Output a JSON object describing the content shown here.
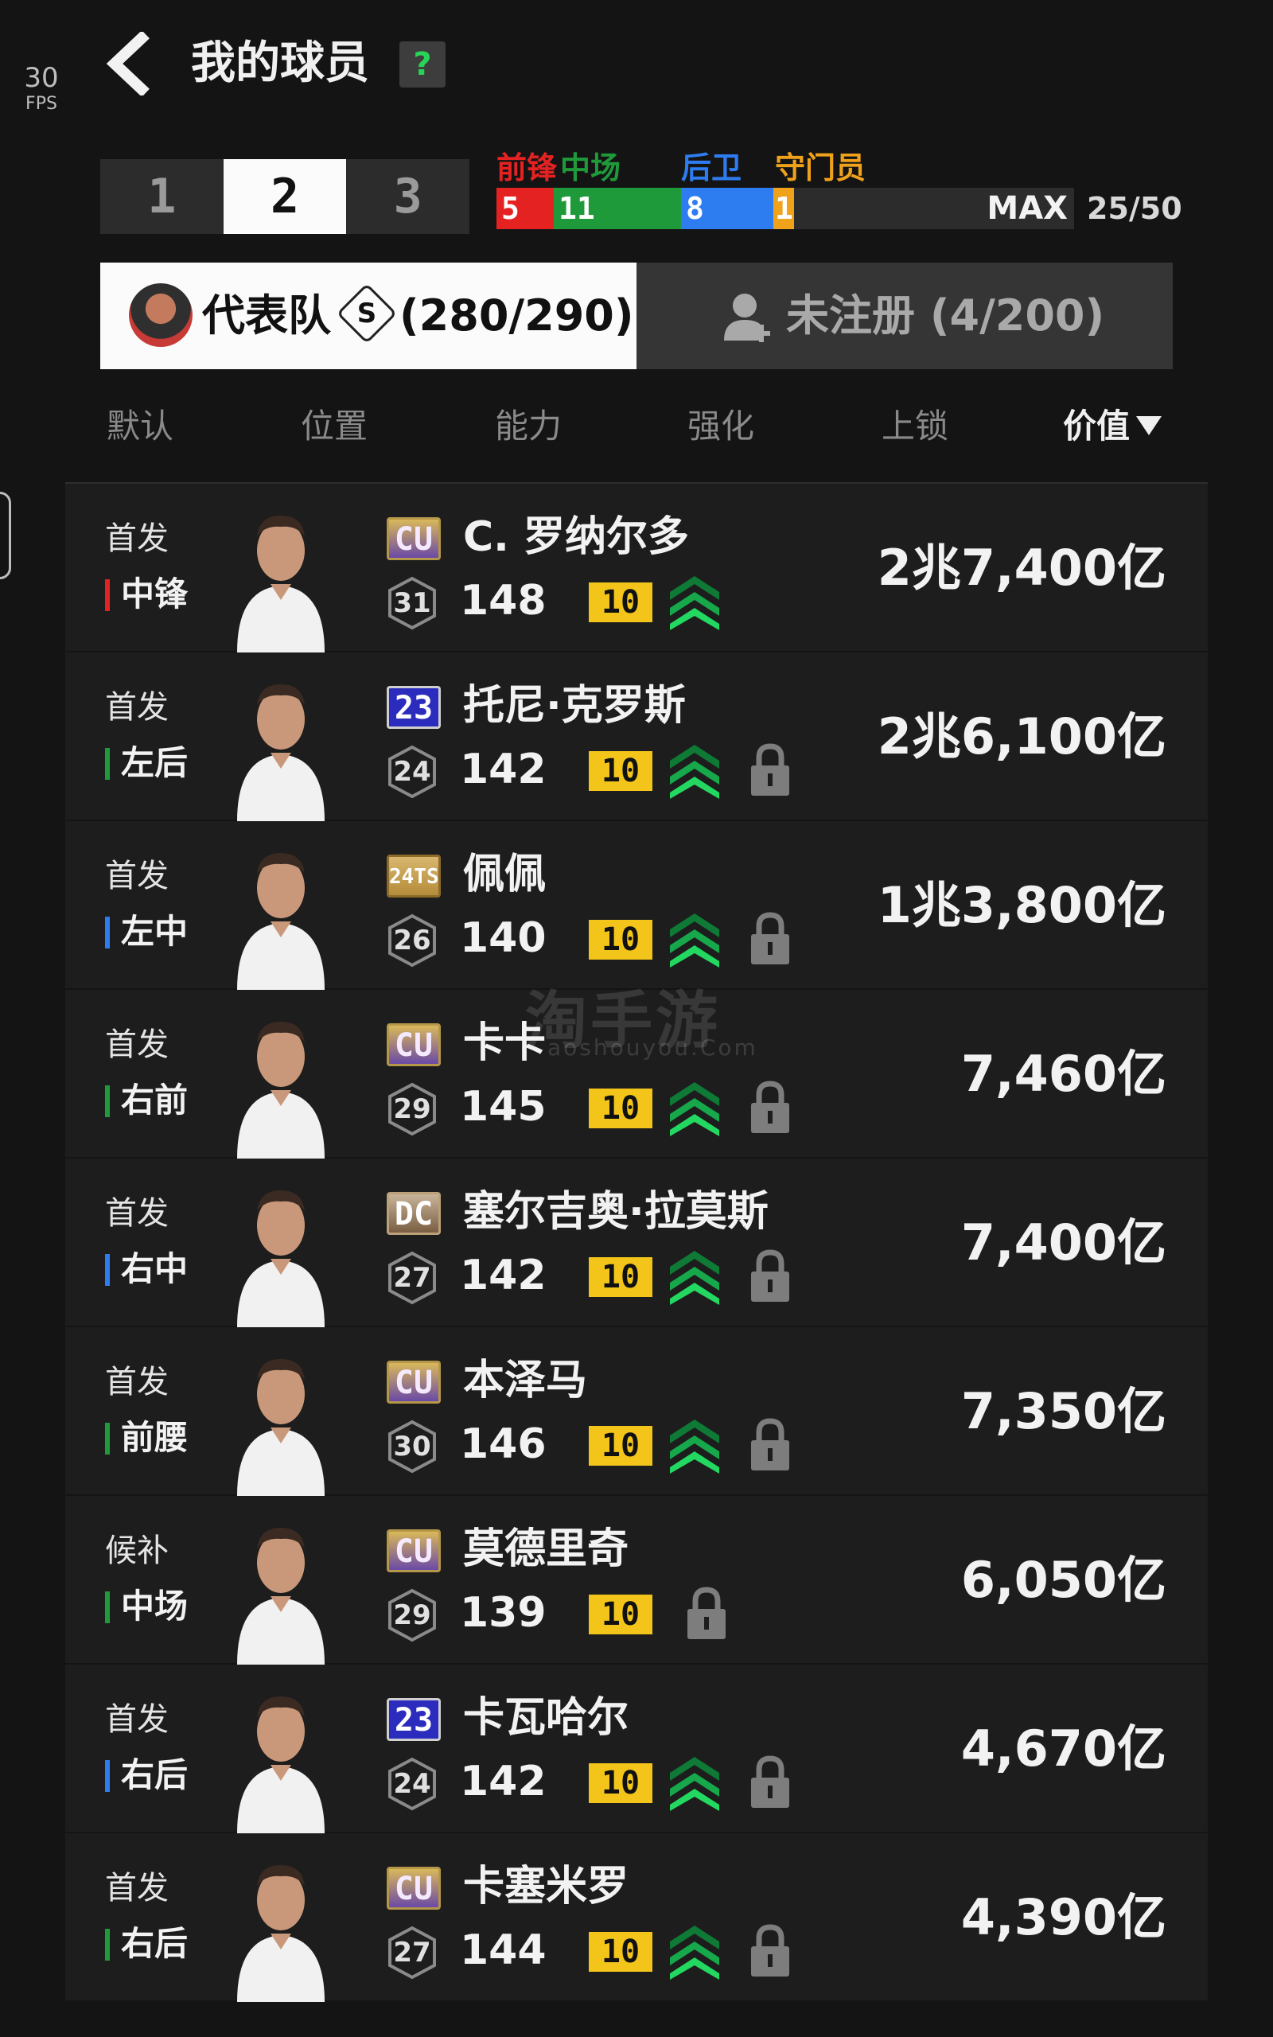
{
  "fps": {
    "value": "30",
    "label": "FPS"
  },
  "header": {
    "title": "我的球员",
    "help": "?"
  },
  "pages": [
    "1",
    "2",
    "3"
  ],
  "active_page": "2",
  "positions": {
    "labels": {
      "forward": "前锋",
      "midfield": "中场",
      "defender": "后卫",
      "goalkeeper": "守门员"
    },
    "counts": {
      "forward": "5",
      "midfield": "11",
      "defender": "8",
      "goalkeeper": "1"
    },
    "colors": {
      "forward": "#e42222",
      "midfield": "#1f9a3b",
      "defender": "#2e7df0",
      "goalkeeper": "#f0a21b"
    },
    "max_label": "MAX",
    "total": "25/50"
  },
  "tabs": {
    "squad": {
      "label": "代表队",
      "coin": "S",
      "count": "(280/290)"
    },
    "unregistered": {
      "label": "未注册",
      "count": "(4/200)"
    }
  },
  "sort": [
    "默认",
    "位置",
    "能力",
    "强化",
    "上锁",
    "价值"
  ],
  "active_sort": "价值",
  "players": [
    {
      "status": "首发",
      "position": "中锋",
      "pos_color": "#e42222",
      "card": "CU",
      "card_type": "cu",
      "name": "C. 罗纳尔多",
      "ovr_badge": "31",
      "ovr": "148",
      "level": "10",
      "boost": true,
      "lock": false,
      "value": "2兆7,400亿"
    },
    {
      "status": "首发",
      "position": "左后",
      "pos_color": "#1f9a3b",
      "card": "23",
      "card_type": "c23",
      "name": "托尼·克罗斯",
      "ovr_badge": "24",
      "ovr": "142",
      "level": "10",
      "boost": true,
      "lock": true,
      "value": "2兆6,100亿"
    },
    {
      "status": "首发",
      "position": "左中",
      "pos_color": "#2e7df0",
      "card": "24TS",
      "card_type": "ts",
      "name": "佩佩",
      "ovr_badge": "26",
      "ovr": "140",
      "level": "10",
      "boost": true,
      "lock": true,
      "value": "1兆3,800亿"
    },
    {
      "status": "首发",
      "position": "右前",
      "pos_color": "#1f9a3b",
      "card": "CU",
      "card_type": "cu",
      "name": "卡卡",
      "ovr_badge": "29",
      "ovr": "145",
      "level": "10",
      "boost": true,
      "lock": true,
      "value": "7,460亿"
    },
    {
      "status": "首发",
      "position": "右中",
      "pos_color": "#2e7df0",
      "card": "DC",
      "card_type": "dc",
      "name": "塞尔吉奥·拉莫斯",
      "ovr_badge": "27",
      "ovr": "142",
      "level": "10",
      "boost": true,
      "lock": true,
      "value": "7,400亿"
    },
    {
      "status": "首发",
      "position": "前腰",
      "pos_color": "#1f9a3b",
      "card": "CU",
      "card_type": "cu",
      "name": "本泽马",
      "ovr_badge": "30",
      "ovr": "146",
      "level": "10",
      "boost": true,
      "lock": true,
      "value": "7,350亿"
    },
    {
      "status": "候补",
      "position": "中场",
      "pos_color": "#1f9a3b",
      "card": "CU",
      "card_type": "cu",
      "name": "莫德里奇",
      "ovr_badge": "29",
      "ovr": "139",
      "level": "10",
      "boost": false,
      "lock": true,
      "value": "6,050亿"
    },
    {
      "status": "首发",
      "position": "右后",
      "pos_color": "#2e7df0",
      "card": "23",
      "card_type": "c23",
      "name": "卡瓦哈尔",
      "ovr_badge": "24",
      "ovr": "142",
      "level": "10",
      "boost": true,
      "lock": true,
      "value": "4,670亿"
    },
    {
      "status": "首发",
      "position": "右后",
      "pos_color": "#1f9a3b",
      "card": "CU",
      "card_type": "cu",
      "name": "卡塞米罗",
      "ovr_badge": "27",
      "ovr": "144",
      "level": "10",
      "boost": true,
      "lock": true,
      "value": "4,390亿"
    }
  ],
  "watermark": {
    "main": "淘手游",
    "sub": "aoshouyou.Com"
  }
}
